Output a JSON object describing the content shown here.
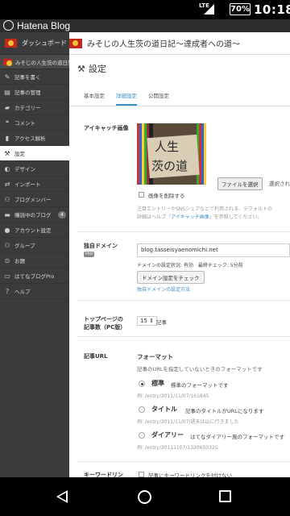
{
  "status_bar": {
    "network": "LTE",
    "battery": "70%",
    "time": "10:18"
  },
  "app": {
    "title": "Hatena Blog"
  },
  "sidebar": {
    "dashboard": "ダッシュボード",
    "blog": "みそじの人生茨の道日記〜達成...",
    "items": [
      {
        "icon": "✎",
        "label": "記事を書く"
      },
      {
        "icon": "▤",
        "label": "記事の管理"
      },
      {
        "icon": "▰",
        "label": "カテゴリー"
      },
      {
        "icon": "❝",
        "label": "コメント"
      },
      {
        "icon": "▮",
        "label": "アクセス解析"
      },
      {
        "icon": "⚒",
        "label": "設定"
      },
      {
        "icon": "◐",
        "label": "デザイン"
      },
      {
        "icon": "⇄",
        "label": "インポート"
      },
      {
        "icon": "⚇",
        "label": "ブログメンバー"
      },
      {
        "icon": "▬",
        "label": "購読中のブログ",
        "badge": "4"
      },
      {
        "icon": "●",
        "label": "アカウント設定"
      },
      {
        "icon": "⚇",
        "label": "グループ"
      },
      {
        "icon": "⊙",
        "label": "お題"
      },
      {
        "icon": "▭",
        "label": "はてなブログPro"
      },
      {
        "icon": "?",
        "label": "ヘルプ"
      }
    ]
  },
  "header": {
    "blog_title": "みそじの人生茨の道日記〜達成者への道〜"
  },
  "settings": {
    "title": "設定",
    "tabs": [
      "基本設定",
      "詳細設定",
      "公開設定"
    ],
    "eyecatch": {
      "label": "アイキャッチ画像",
      "image_text_1": "人生",
      "image_text_2": "茨の道",
      "file_button": "ファイルを選択",
      "file_status": "選択され",
      "delete_label": "画像を削除する",
      "note1": "注目エントリーやSNSシェアなどで利用される、デフォルトの",
      "note2_prefix": "詳細はヘルプ「",
      "note2_link": "アイキャッチ画像",
      "note2_suffix": "」を参照してください。"
    },
    "domain": {
      "label": "独自ドメイン",
      "pro": "PRO",
      "value": "blog.tasseisyaenomichi.net",
      "status": "ドメインの設定状況: 有効　最終チェック: 5分前",
      "check_button": "ドメイン設定をチェック",
      "help_link": "独自ドメインの設定方法"
    },
    "toppage": {
      "label1": "トップページの",
      "label2": "記事数（PC版）",
      "select": "15 ⇕",
      "unit": "記事"
    },
    "url": {
      "label": "記事URL",
      "format_title": "フォーマット",
      "desc": "記事のURLを指定していないときのフォーマットです",
      "options": [
        {
          "name": "標準",
          "desc": "標準のフォーマットです",
          "example": "例: /entry/2011/11/07/161845",
          "selected": true
        },
        {
          "name": "タイトル",
          "desc": "記事のタイトルがURLになります",
          "example": "例: /entry/2011/11/07/週末は山に行きました",
          "selected": false
        },
        {
          "name": "ダイアリー",
          "desc": "はてなダイアリー風のフォーマットです",
          "example": "例: /entry/20111107/1320650325",
          "selected": false
        }
      ]
    },
    "keyword": {
      "label": "キーワードリン",
      "desc": "記事にキーワードリンクを付けない"
    }
  }
}
